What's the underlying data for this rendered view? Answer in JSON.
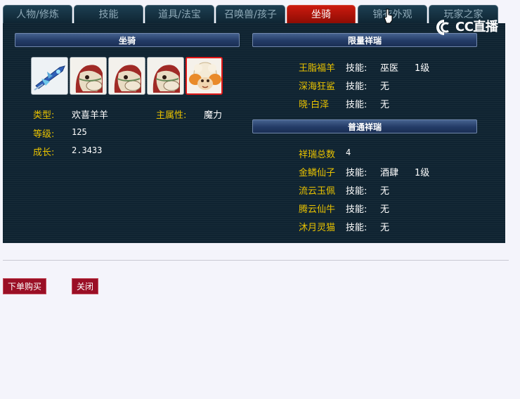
{
  "tabs": [
    {
      "label": "人物/修炼",
      "active": false
    },
    {
      "label": "技能",
      "active": false
    },
    {
      "label": "道具/法宝",
      "active": false
    },
    {
      "label": "召唤兽/孩子",
      "active": false
    },
    {
      "label": "坐骑",
      "active": true
    },
    {
      "label": "锦衣外观",
      "active": false
    },
    {
      "label": "玩家之家",
      "active": false
    }
  ],
  "logo": {
    "text": "CC直播"
  },
  "mount_section": {
    "title": "坐骑",
    "slots": [
      {
        "icon": "flying-sword-mount-icon",
        "selected": false
      },
      {
        "icon": "horse-mount-icon",
        "selected": false
      },
      {
        "icon": "horse-mount-icon",
        "selected": false
      },
      {
        "icon": "horse-mount-icon",
        "selected": false
      },
      {
        "icon": "sheep-mount-icon",
        "selected": true
      }
    ],
    "type_label": "类型:",
    "type_value": "欢喜羊羊",
    "attr_label": "主属性:",
    "attr_value": "魔力",
    "level_label": "等级:",
    "level_value": "125",
    "growth_label": "成长:",
    "growth_value": "2.3433"
  },
  "limited_section": {
    "title": "限量祥瑞",
    "items": [
      {
        "name": "王脂福羊",
        "skill_label": "技能:",
        "skill": "巫医",
        "level": "1级"
      },
      {
        "name": "深海狂鲨",
        "skill_label": "技能:",
        "skill": "无",
        "level": ""
      },
      {
        "name": "晓·白泽",
        "skill_label": "技能:",
        "skill": "无",
        "level": ""
      }
    ]
  },
  "normal_section": {
    "title": "普通祥瑞",
    "total_label": "祥瑞总数",
    "total_value": "4",
    "items": [
      {
        "name": "金鳞仙子",
        "skill_label": "技能:",
        "skill": "酒肆",
        "level": "1级"
      },
      {
        "name": "流云玉佩",
        "skill_label": "技能:",
        "skill": "无",
        "level": ""
      },
      {
        "name": "腾云仙牛",
        "skill_label": "技能:",
        "skill": "无",
        "level": ""
      },
      {
        "name": "沐月灵猫",
        "skill_label": "技能:",
        "skill": "无",
        "level": ""
      }
    ]
  },
  "buttons": {
    "buy": "下单购买",
    "close": "关闭"
  },
  "colors": {
    "accent_yellow": "#e8c200",
    "active_tab": "#c01408",
    "panel_bg": "#0f2331",
    "button_bg": "#9a0f25"
  }
}
